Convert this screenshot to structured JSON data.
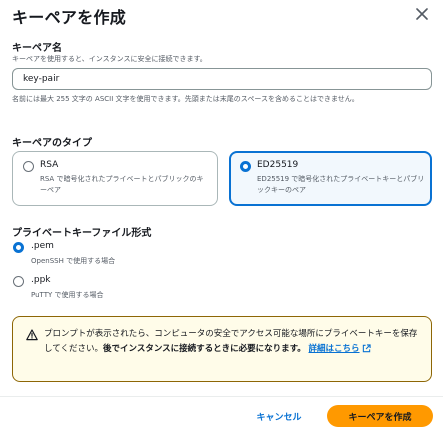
{
  "modal": {
    "title": "キーペアを作成",
    "close_icon": "close-icon"
  },
  "name_field": {
    "label": "キーペア名",
    "description": "キーペアを使用すると、インスタンスに安全に接続できます。",
    "value": "key-pair",
    "constraint": "名前には最大 255 文字の ASCII 文字を使用できます。先頭または末尾のスペースを含めることはできません。"
  },
  "key_type": {
    "label": "キーペアのタイプ",
    "selected": "ED25519",
    "options": [
      {
        "title": "RSA",
        "description": "RSA で暗号化されたプライベートとパブリックのキーペア",
        "checked": false
      },
      {
        "title": "ED25519",
        "description": "ED25519 で暗号化されたプライベートキーとパブリックキーのペア",
        "checked": true
      }
    ]
  },
  "file_format": {
    "label": "プライベートキーファイル形式",
    "selected": ".pem",
    "options": [
      {
        "title": ".pem",
        "description": "OpenSSH で使用する場合",
        "checked": true
      },
      {
        "title": ".ppk",
        "description": "PuTTY で使用する場合",
        "checked": false
      }
    ]
  },
  "alert": {
    "icon": "warning-icon",
    "text": "プロンプトが表示されたら、コンピュータの安全でアクセス可能な場所にプライベートキーを保存してください。",
    "strong_text": "後でインスタンスに接続するときに必要になります。",
    "link_text": "詳細はこちら",
    "link_icon": "external-link-icon",
    "color": "#8d6605"
  },
  "footer": {
    "cancel_label": "キャンセル",
    "create_label": "キーペアを作成"
  },
  "colors": {
    "accent": "#0972d3",
    "primary_button": "#ff9900",
    "alert_background": "#fffce9"
  }
}
